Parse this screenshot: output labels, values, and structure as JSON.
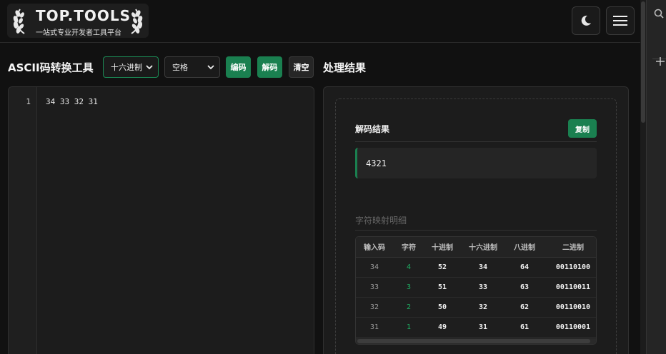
{
  "header": {
    "logo_title": "TOP.TOOLS",
    "logo_subtitle": "一站式专业开发者工具平台"
  },
  "toolbar": {
    "page_title": "ASCII码转换工具",
    "format_select": "十六进制",
    "separator_select": "空格",
    "encode_label": "编码",
    "decode_label": "解码",
    "clear_label": "清空"
  },
  "editor": {
    "line_number": "1",
    "content": "34 33 32 31"
  },
  "result": {
    "section_title": "处理结果",
    "decode_label": "解码结果",
    "copy_label": "复制",
    "output": "4321",
    "mapping_label": "字符映射明细",
    "table_headers": [
      "输入码",
      "字符",
      "十进制",
      "十六进制",
      "八进制",
      "二进制"
    ],
    "rows": [
      [
        "34",
        "4",
        "52",
        "34",
        "64",
        "00110100"
      ],
      [
        "33",
        "3",
        "51",
        "33",
        "63",
        "00110011"
      ],
      [
        "32",
        "2",
        "50",
        "32",
        "62",
        "00110010"
      ],
      [
        "31",
        "1",
        "49",
        "31",
        "61",
        "00110001"
      ]
    ]
  },
  "colors": {
    "accent": "#1a8050",
    "background": "#111111",
    "panel": "#1c1c1c"
  },
  "icons": [
    "laurel-icon",
    "moon-icon",
    "hamburger-menu-icon",
    "search-icon",
    "plus-icon",
    "chevron-down-icon"
  ]
}
